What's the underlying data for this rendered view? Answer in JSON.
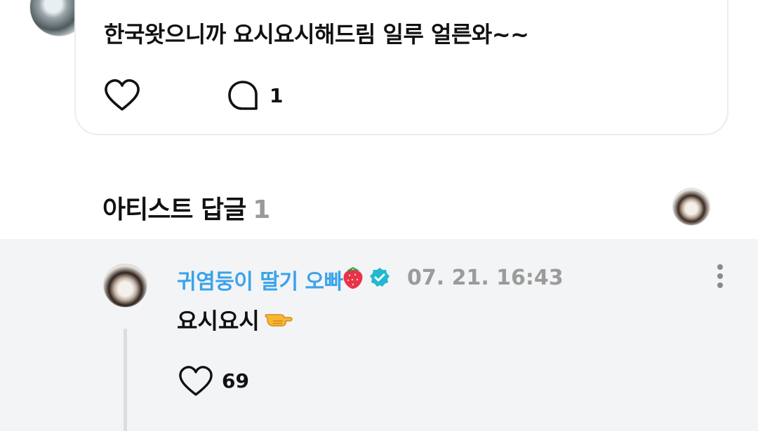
{
  "post": {
    "text": "한국왓으니까 요시요시해드림 일루 얼른와~~",
    "comment_count": "1"
  },
  "artist_replies": {
    "title": "아티스트 답글",
    "count": "1"
  },
  "reply": {
    "author": "귀염둥이 딸기 오빠",
    "author_emoji": "strawberry-icon",
    "timestamp": "07. 21. 16:43",
    "text": "요시요시",
    "like_count": "69",
    "author_color": "#3aa3ea",
    "verified_color": "#22b8cf"
  }
}
